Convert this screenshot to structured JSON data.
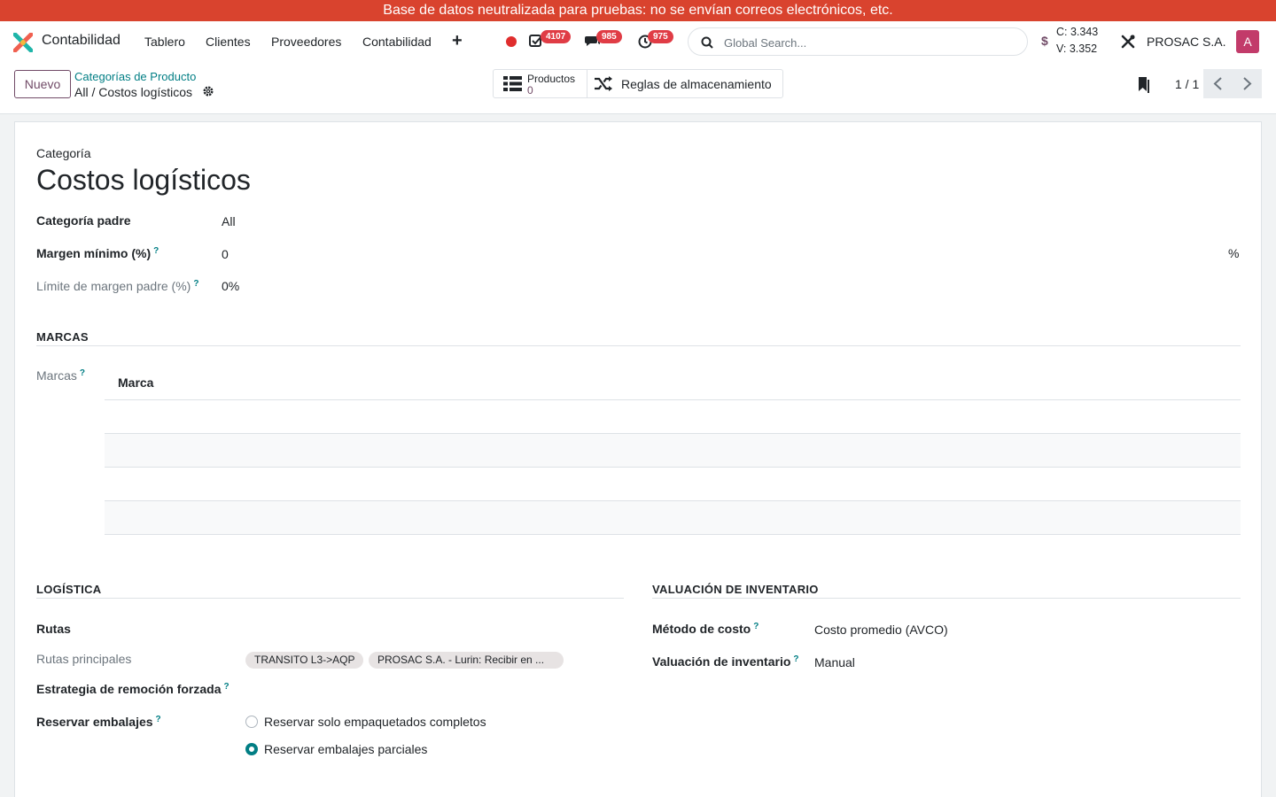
{
  "banner": {
    "text": "Base de datos neutralizada para pruebas: no se envían correos electrónicos, etc."
  },
  "navbar": {
    "app_name": "Contabilidad",
    "menu": [
      "Tablero",
      "Clientes",
      "Proveedores",
      "Contabilidad"
    ],
    "badges": {
      "activities": "4107",
      "messages": "985",
      "timers": "975"
    },
    "search_placeholder": "Global Search...",
    "currency_symbol": "$",
    "rate_buy": "C: 3.343",
    "rate_sell": "V: 3.352",
    "company": "PROSAC S.A.",
    "avatar_letter": "A"
  },
  "control_panel": {
    "new_label": "Nuevo",
    "breadcrumb_parent": "Categorías de Producto",
    "breadcrumb_current": "All / Costos logísticos",
    "smart_products_label": "Productos",
    "smart_products_value": "0",
    "smart_rules_label": "Reglas de almacenamiento",
    "pager": "1 / 1"
  },
  "form": {
    "category_label": "Categoría",
    "category_name": "Costos logísticos",
    "parent_label": "Categoría padre",
    "parent_value": "All",
    "min_margin_label": "Margen mínimo (%)",
    "min_margin_value": "0",
    "min_margin_unit": "%",
    "parent_margin_label": "Límite de margen padre (%)",
    "parent_margin_value": "0%",
    "brands_section": "MARCAS",
    "brands_label": "Marcas",
    "brands_column": "Marca",
    "logistics_section": "LOGÍSTICA",
    "routes_label": "Rutas",
    "main_routes_label": "Rutas principales",
    "routes_tags": [
      "TRANSITO L3->AQP",
      "PROSAC S.A. - Lurin: Recibir en ..."
    ],
    "removal_label": "Estrategia de remoción forzada",
    "packaging_label": "Reservar embalajes",
    "packaging_options": [
      "Reservar solo empaquetados completos",
      "Reservar embalajes parciales"
    ],
    "packaging_selected": 1,
    "valuation_section": "VALUACIÓN DE INVENTARIO",
    "cost_method_label": "Método de costo",
    "cost_method_value": "Costo promedio (AVCO)",
    "valuation_label": "Valuación de inventario",
    "valuation_value": "Manual"
  }
}
